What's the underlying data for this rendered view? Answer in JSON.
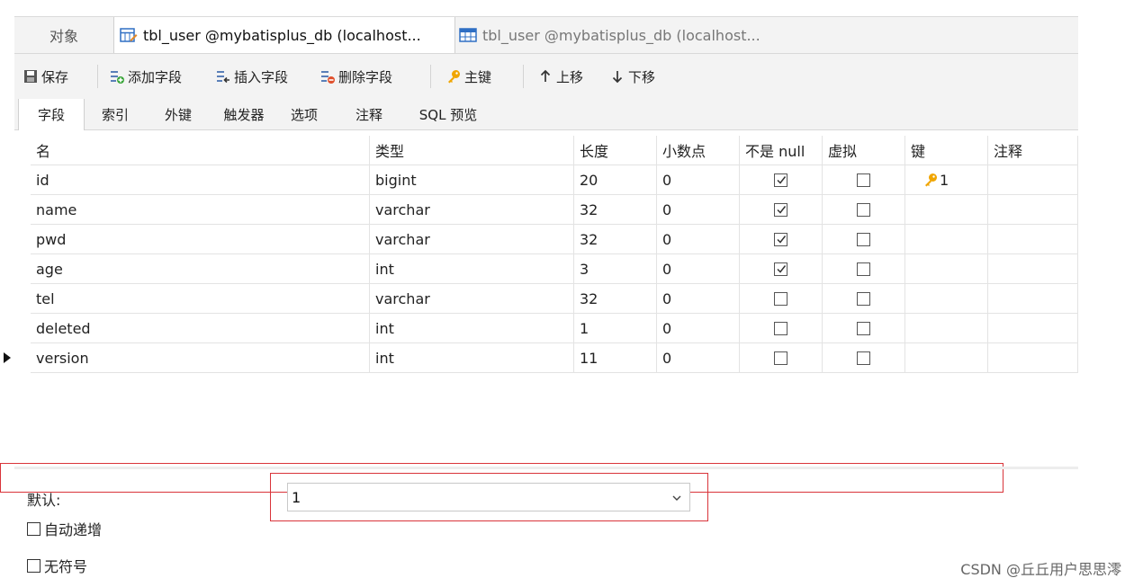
{
  "doc_tabs": {
    "objects": "对象",
    "active": "tbl_user @mybatisplus_db (localhost...",
    "inactive": "tbl_user @mybatisplus_db (localhost..."
  },
  "toolbar": {
    "save": "保存",
    "add_field": "添加字段",
    "insert_field": "插入字段",
    "delete_field": "删除字段",
    "primary_key": "主键",
    "move_up": "上移",
    "move_down": "下移"
  },
  "sub_tabs": [
    "字段",
    "索引",
    "外键",
    "触发器",
    "选项",
    "注释",
    "SQL 预览"
  ],
  "grid": {
    "headers": [
      "名",
      "类型",
      "长度",
      "小数点",
      "不是 null",
      "虚拟",
      "键",
      "注释"
    ],
    "rows": [
      {
        "name": "id",
        "type": "bigint",
        "length": "20",
        "decimals": "0",
        "not_null": true,
        "virtual": false,
        "key": "1"
      },
      {
        "name": "name",
        "type": "varchar",
        "length": "32",
        "decimals": "0",
        "not_null": true,
        "virtual": false,
        "key": ""
      },
      {
        "name": "pwd",
        "type": "varchar",
        "length": "32",
        "decimals": "0",
        "not_null": true,
        "virtual": false,
        "key": ""
      },
      {
        "name": "age",
        "type": "int",
        "length": "3",
        "decimals": "0",
        "not_null": true,
        "virtual": false,
        "key": ""
      },
      {
        "name": "tel",
        "type": "varchar",
        "length": "32",
        "decimals": "0",
        "not_null": false,
        "virtual": false,
        "key": ""
      },
      {
        "name": "deleted",
        "type": "int",
        "length": "1",
        "decimals": "0",
        "not_null": false,
        "virtual": false,
        "key": ""
      },
      {
        "name": "version",
        "type": "int",
        "length": "11",
        "decimals": "0",
        "not_null": false,
        "virtual": false,
        "key": ""
      }
    ]
  },
  "bottom": {
    "default_label": "默认:",
    "default_value": "1",
    "auto_increment": "自动递增",
    "unsigned": "无符号"
  },
  "watermark": "CSDN @丘丘用户思思澪",
  "colors": {
    "highlight": "#d9343a",
    "key_icon": "#f0a500"
  }
}
